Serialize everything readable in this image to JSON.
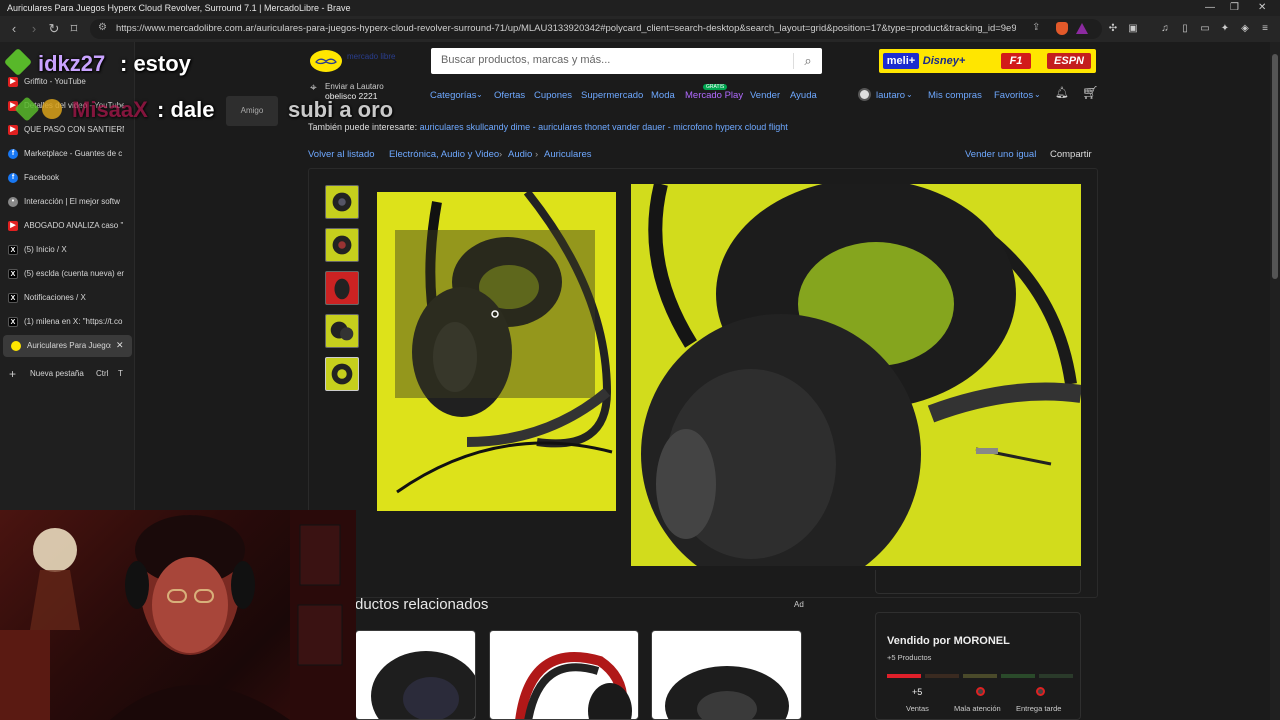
{
  "window": {
    "title": "Auriculares Para Juegos Hyperx Cloud Revolver, Surround 7.1 | MercadoLibre - Brave",
    "controls": [
      "—",
      "❐",
      "✕"
    ]
  },
  "address_bar": {
    "url": "https://www.mercadolibre.com.ar/auriculares-para-juegos-hyperx-cloud-revolver-surround-71/up/MLAU3133920342#polycard_client=search-desktop&search_layout=grid&position=17&type=product&tracking_id=9e9..."
  },
  "sidebar_tabs": [
    {
      "label": "Griffito - YouTube",
      "icon": "youtube-icon"
    },
    {
      "label": "Detalles del video - YouTube",
      "icon": "youtube-icon"
    },
    {
      "label": "QUE PASÓ CON SANTIERNO",
      "icon": "youtube-icon"
    },
    {
      "label": "Marketplace - Guantes de c",
      "icon": "facebook-icon"
    },
    {
      "label": "Facebook",
      "icon": "facebook-icon"
    },
    {
      "label": "Interacción | El mejor softw",
      "icon": "generic-icon"
    },
    {
      "label": "ABOGADO ANALIZA caso \"",
      "icon": "youtube-icon"
    },
    {
      "label": "(5) Inicio / X",
      "icon": "x-icon"
    },
    {
      "label": "(5) esclda (cuenta nueva) en",
      "icon": "x-icon"
    },
    {
      "label": "Notificaciones / X",
      "icon": "x-icon"
    },
    {
      "label": "(1) milena en X: \"https://t.co",
      "icon": "x-icon"
    },
    {
      "label": "Auriculares Para Juegos",
      "icon": "mercadolibre-icon",
      "active": true
    }
  ],
  "new_tab": {
    "label": "Nueva pestaña",
    "shortcut_mod": "Ctrl",
    "shortcut_key": "T"
  },
  "header": {
    "logo_text": "mercado libre",
    "search_placeholder": "Buscar productos, marcas y más...",
    "promo": {
      "meli": "meli+",
      "disney": "Disney+",
      "f1": "F1",
      "espn": "ESPN"
    },
    "deliver_line1": "Enviar a Lautaro",
    "deliver_line2": "obelisco 2221",
    "nav": [
      "Categorías",
      "Ofertas",
      "Cupones",
      "Supermercado",
      "Moda",
      "Mercado Play",
      "Vender",
      "Ayuda"
    ],
    "mercado_play_badge": "GRATIS",
    "user": "lautaro",
    "mis_compras": "Mis compras",
    "favoritos": "Favoritos"
  },
  "suggestions": {
    "prefix": "También puede interesarte:",
    "links": "auriculares skullcandy dime - auriculares thonet vander dauer - microfono hyperx cloud flight"
  },
  "breadcrumb": {
    "back": "Volver al listado",
    "items": [
      "Electrónica, Audio y Video",
      "Audio",
      "Auriculares"
    ],
    "sell_similar": "Vender uno igual",
    "share": "Compartir"
  },
  "related": {
    "title": "ductos relacionados",
    "ad": "Ad"
  },
  "seller": {
    "name": "Vendido por MORONEL",
    "products": "+5 Productos",
    "sales_value": "+5",
    "sales_label": "Ventas",
    "attention_label": "Mala atención",
    "delivery_label": "Entrega tarde",
    "rep_colors": [
      "#e0202a",
      "#3a2a20",
      "#4a4a2a",
      "#2a4a2a",
      "#2a3a2a"
    ]
  },
  "overlay": {
    "line1_user": "idkz27",
    "line1_msg": ": estoy",
    "line2_user": "MisaaX",
    "line2_msg": ": dale",
    "line2_badge": "Amigo",
    "line2_extra": "subi a oro"
  }
}
